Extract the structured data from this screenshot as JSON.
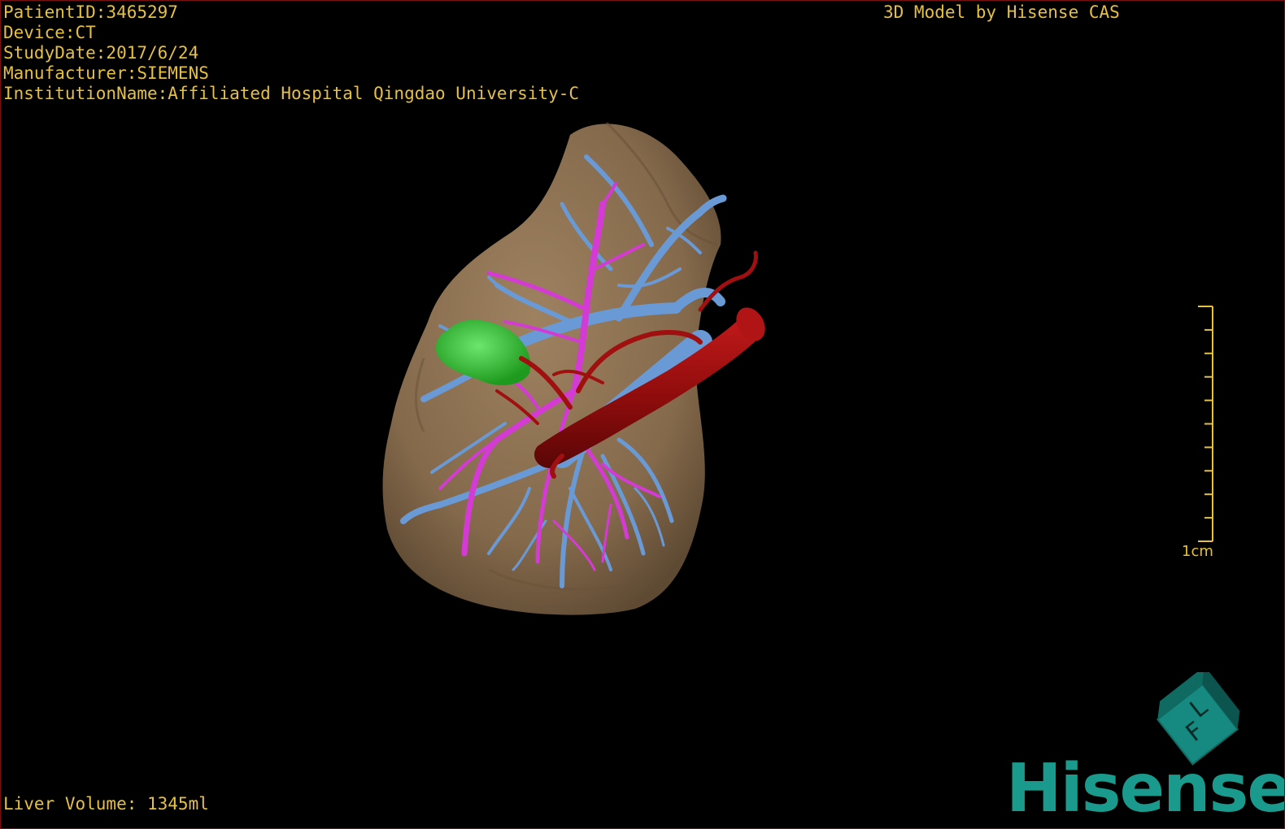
{
  "study_info": {
    "patient_id": "PatientID:3465297",
    "device": "Device:CT",
    "study_date": "StudyDate:2017/6/24",
    "manufacturer": "Manufacturer:SIEMENS",
    "institution": "InstitutionName:Affiliated Hospital Qingdao University-C"
  },
  "model_caption": "3D Model by Hisense CAS",
  "liver_volume": "Liver Volume: 1345ml",
  "scale_bar": {
    "label": "1cm",
    "tick_count": 10
  },
  "orientation_cube": {
    "face_letters": [
      "F",
      "L"
    ]
  },
  "brand_logo": "Hisense",
  "colors": {
    "overlay_text": "#e6c040",
    "liver": "#8b7052",
    "portal_vein": "#6a9ad6",
    "hepatic_artery": "#d43ad4",
    "vena_cava": "#a01010",
    "tumor": "#2fbf2f",
    "brand": "#1a9a8c"
  },
  "icons": {
    "orientation_cube": "orientation-cube-icon",
    "brand": "hisense-logo"
  }
}
